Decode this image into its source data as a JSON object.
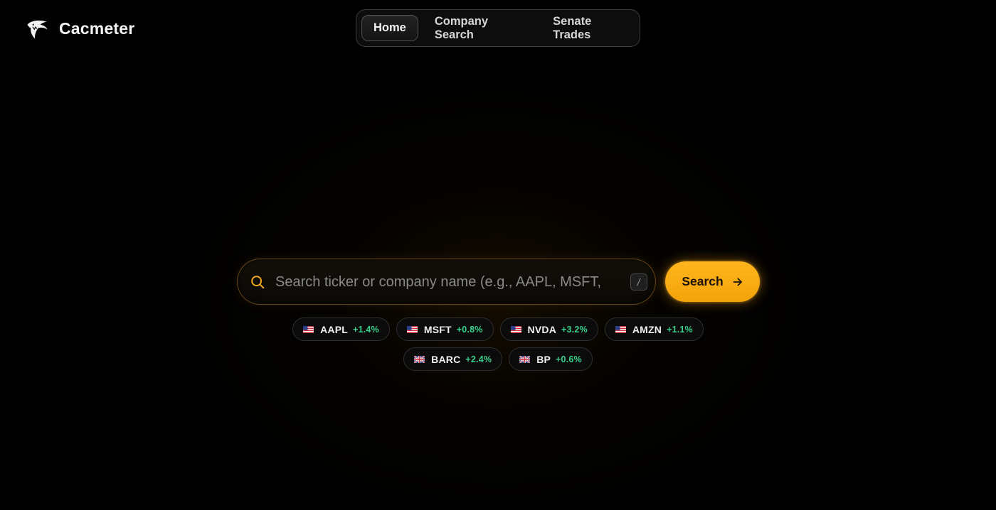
{
  "brand": {
    "name": "Cacmeter",
    "logo_icon": "shark-logo-icon"
  },
  "nav": {
    "items": [
      {
        "label": "Home",
        "active": true
      },
      {
        "label": "Company Search",
        "active": false
      },
      {
        "label": "Senate Trades",
        "active": false
      }
    ]
  },
  "search": {
    "placeholder": "Search ticker or company name (e.g., AAPL, MSFT, BARC)",
    "value": "",
    "shortcut": "/",
    "button_label": "Search",
    "icon": "search-icon",
    "button_icon": "arrow-right-icon"
  },
  "tickers": [
    {
      "flag": "us-flag-icon",
      "symbol": "AAPL",
      "change": "+1.4%"
    },
    {
      "flag": "us-flag-icon",
      "symbol": "MSFT",
      "change": "+0.8%"
    },
    {
      "flag": "us-flag-icon",
      "symbol": "NVDA",
      "change": "+3.2%"
    },
    {
      "flag": "us-flag-icon",
      "symbol": "AMZN",
      "change": "+1.1%"
    },
    {
      "flag": "uk-flag-icon",
      "symbol": "BARC",
      "change": "+2.4%"
    },
    {
      "flag": "uk-flag-icon",
      "symbol": "BP",
      "change": "+0.6%"
    }
  ],
  "colors": {
    "accent": "#f5a60c",
    "positive": "#3ad08d",
    "background": "#000000"
  }
}
